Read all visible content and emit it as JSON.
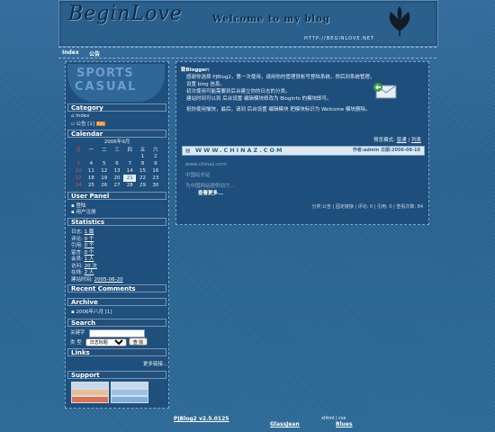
{
  "banner": {
    "logo": "BeginLove",
    "welcome": "Welcome to my blog",
    "url": "HTTP://BEGINLOVE.NET"
  },
  "nav": {
    "items": [
      "Index",
      "公告"
    ]
  },
  "sidebar": {
    "pocket_line1": "SPORTS",
    "pocket_line2": "CASUAL",
    "category": {
      "title": "Category",
      "items": [
        "Index",
        "公告 [1]"
      ],
      "badge": "RSS"
    },
    "calendar": {
      "title": "Calendar",
      "month": "2006年9月",
      "weekdays": [
        "日",
        "一",
        "二",
        "三",
        "四",
        "五",
        "六"
      ],
      "weeks": [
        [
          "",
          "",
          "",
          "",
          "",
          "1",
          "2"
        ],
        [
          "3",
          "4",
          "5",
          "6",
          "7",
          "8",
          "9"
        ],
        [
          "10",
          "11",
          "12",
          "13",
          "14",
          "15",
          "16"
        ],
        [
          "17",
          "18",
          "19",
          "20",
          "21",
          "22",
          "23"
        ],
        [
          "24",
          "25",
          "26",
          "27",
          "28",
          "29",
          "30"
        ]
      ],
      "today": "21"
    },
    "user_panel": {
      "title": "User Panel",
      "items": [
        "登陆",
        "用户注册"
      ]
    },
    "statistics": {
      "title": "Statistics",
      "rows": [
        {
          "label": "日志:",
          "value": "1 篇"
        },
        {
          "label": "评论:",
          "value": "0 个"
        },
        {
          "label": "引用:",
          "value": "0 个"
        },
        {
          "label": "留言:",
          "value": "0 个"
        },
        {
          "label": "会员:",
          "value": "1 人"
        },
        {
          "label": "访问:",
          "value": "20 次"
        },
        {
          "label": "在线:",
          "value": "2 人"
        },
        {
          "label": "建站时间:",
          "value": "2005-06-20"
        }
      ]
    },
    "recent_comments": {
      "title": "Recent Comments"
    },
    "archive": {
      "title": "Archive",
      "items": [
        "2006年八月 [1]"
      ]
    },
    "search": {
      "title": "Search",
      "keyword_label": "关键字",
      "type_label": "类  型",
      "type_value": "日志标题",
      "button": "查 找"
    },
    "links": {
      "title": "Links",
      "more": "更多链接..."
    },
    "support": {
      "title": "Support"
    }
  },
  "main": {
    "greeting": "致Blogger:",
    "p1": "感谢你选择 PJBlog2，第一次使用，请用你的管理员帐号登陆系统，然后到系统管理，设置 blog 信息。",
    "p2": "初次使用可能需要到后台建立你的日志的分类。",
    "p3": "建站时间可以到 后台设置 编辑模块修改为 BlogInfo 的模块即可。",
    "p4": "祝你使用愉快，最后，请到 后台设置 编辑模块 把模块标识为 Welcome 模块删除。",
    "view_mode_label": "预览模式:",
    "view_normal": "普通",
    "view_list": "列表",
    "entry_site": "WWW.CHINAZ.COM",
    "entry_author": "作者:admin 日期:2006-08-10",
    "entry_link1": "www.chinaz.com",
    "entry_link2": "中国站长站",
    "entry_link3": "为中国网站提供动力...",
    "read_more": "查看更多...",
    "meta": "分类:公告 | 固定链接 | 评论: 0 | 引用: 0 | 查看次数: 84"
  },
  "footer": {
    "powered": "PJBlog2 v2.5.0125",
    "skin": "GlassJean",
    "valid": "xhtml | css",
    "design": "Blues"
  }
}
